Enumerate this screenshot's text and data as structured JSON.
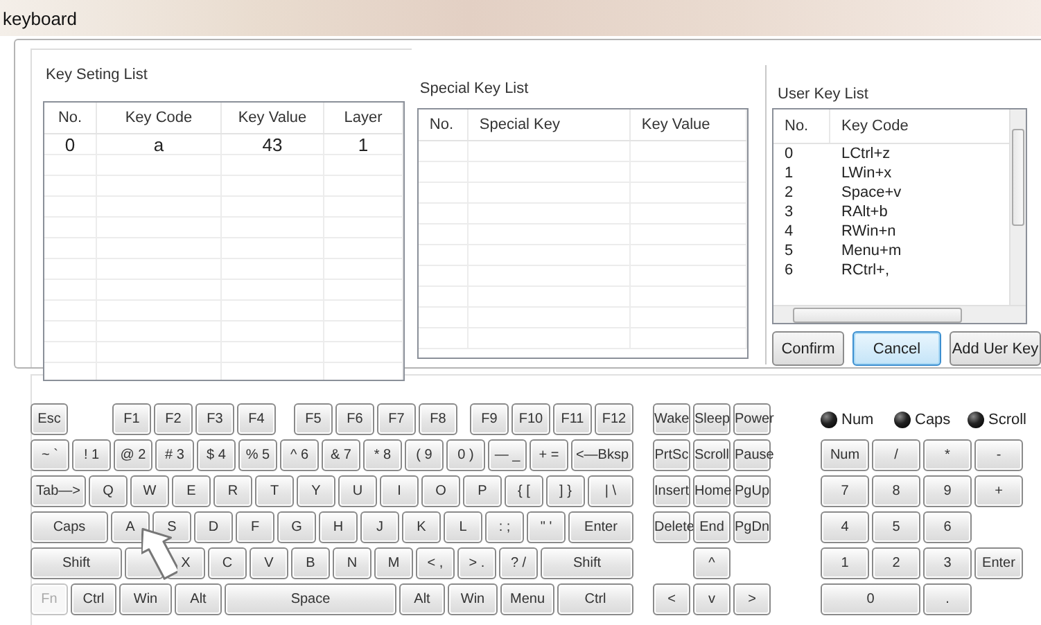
{
  "window": {
    "title": "keyboard"
  },
  "key_setting_list": {
    "title": "Key Seting List",
    "columns": [
      "No.",
      "Key Code",
      "Key Value",
      "Layer"
    ],
    "rows": [
      [
        "0",
        "a",
        "43",
        "1"
      ]
    ]
  },
  "special_key_list": {
    "title": "Special Key List",
    "columns": [
      "No.",
      "Special Key",
      "Key Value"
    ]
  },
  "user_key_list": {
    "title": "User Key List",
    "columns": [
      "No.",
      "Key Code"
    ],
    "rows": [
      [
        "0",
        "LCtrl+z"
      ],
      [
        "1",
        "LWin+x"
      ],
      [
        "2",
        "Space+v"
      ],
      [
        "3",
        "RAlt+b"
      ],
      [
        "4",
        "RWin+n"
      ],
      [
        "5",
        "Menu+m"
      ],
      [
        "6",
        "RCtrl+,"
      ]
    ]
  },
  "buttons": [
    {
      "label": "Confirm",
      "focused": false
    },
    {
      "label": "Cancel",
      "focused": true
    },
    {
      "label": "Add Uer Key",
      "focused": false
    }
  ],
  "keyboard": {
    "main_rows": [
      [
        {
          "label": "Esc"
        },
        {
          "label": "F1"
        },
        {
          "label": "F2"
        },
        {
          "label": "F3"
        },
        {
          "label": "F4"
        },
        {
          "label": "F5"
        },
        {
          "label": "F6"
        },
        {
          "label": "F7"
        },
        {
          "label": "F8"
        },
        {
          "label": "F9"
        },
        {
          "label": "F10"
        },
        {
          "label": "F11"
        },
        {
          "label": "F12"
        }
      ],
      [
        {
          "label": "~ `"
        },
        {
          "label": "! 1"
        },
        {
          "label": "@ 2"
        },
        {
          "label": "# 3"
        },
        {
          "label": "$ 4"
        },
        {
          "label": "% 5"
        },
        {
          "label": "^ 6"
        },
        {
          "label": "& 7"
        },
        {
          "label": "* 8"
        },
        {
          "label": "( 9"
        },
        {
          "label": "0 )"
        },
        {
          "label": "— _"
        },
        {
          "label": "+ ="
        },
        {
          "label": "<—Bksp"
        }
      ],
      [
        {
          "label": "Tab—>"
        },
        {
          "label": "Q"
        },
        {
          "label": "W"
        },
        {
          "label": "E"
        },
        {
          "label": "R"
        },
        {
          "label": "T"
        },
        {
          "label": "Y"
        },
        {
          "label": "U"
        },
        {
          "label": "I"
        },
        {
          "label": "O"
        },
        {
          "label": "P"
        },
        {
          "label": "{ ["
        },
        {
          "label": "] }"
        },
        {
          "label": "| \\"
        }
      ],
      [
        {
          "label": "Caps"
        },
        {
          "label": "A"
        },
        {
          "label": "S"
        },
        {
          "label": "D"
        },
        {
          "label": "F"
        },
        {
          "label": "G"
        },
        {
          "label": "H"
        },
        {
          "label": "J"
        },
        {
          "label": "K"
        },
        {
          "label": "L"
        },
        {
          "label": ": ;"
        },
        {
          "label": "\" '"
        },
        {
          "label": "Enter"
        }
      ],
      [
        {
          "label": "Shift"
        },
        {},
        {
          "label": "X"
        },
        {
          "label": "C"
        },
        {
          "label": "V"
        },
        {
          "label": "B"
        },
        {
          "label": "N"
        },
        {
          "label": "M"
        },
        {
          "label": "< ,"
        },
        {
          "label": "> ."
        },
        {
          "label": "? /"
        },
        {
          "label": "Shift"
        }
      ],
      [
        {
          "label": "Fn",
          "disabled": true
        },
        {
          "label": "Ctrl",
          "disabled": false
        },
        {
          "label": "Win",
          "disabled": false
        },
        {
          "label": "Alt",
          "disabled": false
        },
        {
          "label": "Space",
          "disabled": false
        },
        {
          "label": "Alt",
          "disabled": false
        },
        {
          "label": "Win",
          "disabled": false
        },
        {
          "label": "Menu",
          "disabled": false
        },
        {
          "label": "Ctrl",
          "disabled": false
        }
      ]
    ],
    "nav_keys": [
      {
        "label": "Wake"
      },
      {
        "label": "Sleep"
      },
      {
        "label": "Power"
      },
      {
        "label": "PrtSc"
      },
      {
        "label": "Scroll"
      },
      {
        "label": "Pause"
      },
      {
        "label": "Insert"
      },
      {
        "label": "Home"
      },
      {
        "label": "PgUp"
      },
      {
        "label": "Delete"
      },
      {
        "label": "End"
      },
      {
        "label": "PgDn"
      },
      {
        "label": "^"
      },
      {
        "label": "<"
      },
      {
        "label": "v"
      },
      {
        "label": ">"
      }
    ],
    "indicators": [
      {
        "label": "Num",
        "on": true
      },
      {
        "label": "Caps",
        "on": true
      },
      {
        "label": "Scroll",
        "on": true
      }
    ],
    "numpad_keys": [
      {
        "label": "Num"
      },
      {
        "label": "/"
      },
      {
        "label": "*"
      },
      {
        "label": "-"
      },
      {
        "label": "7"
      },
      {
        "label": "8"
      },
      {
        "label": "9"
      },
      {
        "label": "+"
      },
      {
        "label": "4"
      },
      {
        "label": "5"
      },
      {
        "label": "6"
      },
      {
        "label": "1"
      },
      {
        "label": "2"
      },
      {
        "label": "3"
      },
      {
        "label": "Enter"
      },
      {
        "label": "0"
      },
      {
        "label": "."
      }
    ]
  }
}
